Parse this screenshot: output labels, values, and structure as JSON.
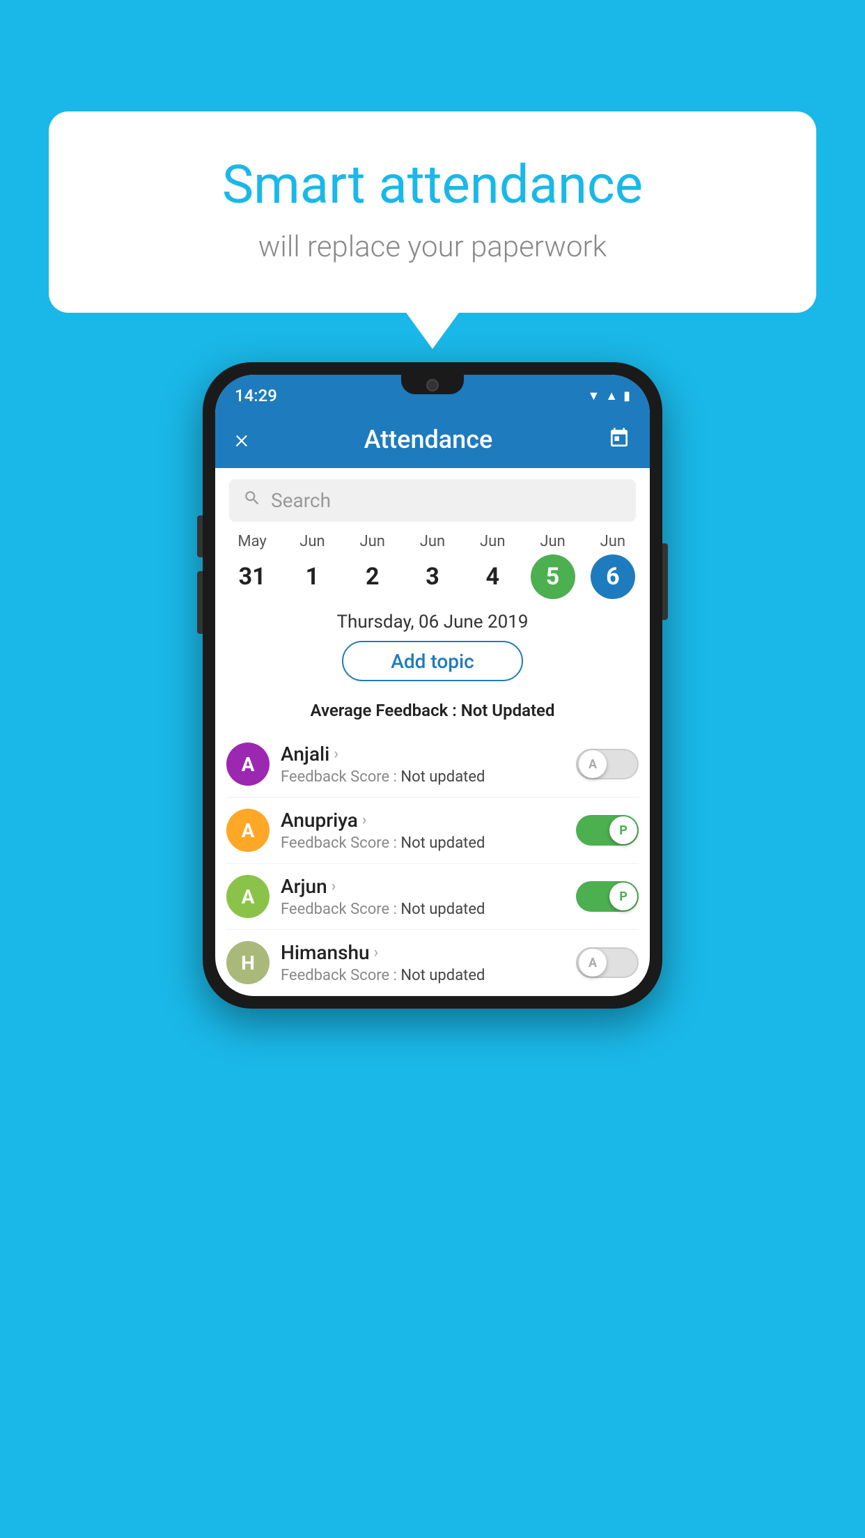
{
  "background_color": "#1ab8e8",
  "speech_bubble": {
    "title": "Smart attendance",
    "subtitle": "will replace your paperwork"
  },
  "status_bar": {
    "time": "14:29",
    "icons": [
      "wifi",
      "signal",
      "battery"
    ]
  },
  "app_bar": {
    "close_label": "×",
    "title": "Attendance",
    "calendar_icon": "calendar"
  },
  "search": {
    "placeholder": "Search"
  },
  "calendar": {
    "days": [
      {
        "month": "May",
        "date": "31",
        "state": "normal"
      },
      {
        "month": "Jun",
        "date": "1",
        "state": "normal"
      },
      {
        "month": "Jun",
        "date": "2",
        "state": "normal"
      },
      {
        "month": "Jun",
        "date": "3",
        "state": "normal"
      },
      {
        "month": "Jun",
        "date": "4",
        "state": "normal"
      },
      {
        "month": "Jun",
        "date": "5",
        "state": "green"
      },
      {
        "month": "Jun",
        "date": "6",
        "state": "blue"
      }
    ]
  },
  "selected_date": "Thursday, 06 June 2019",
  "add_topic_label": "Add topic",
  "average_feedback_label": "Average Feedback :",
  "average_feedback_value": "Not Updated",
  "students": [
    {
      "name": "Anjali",
      "avatar_letter": "A",
      "avatar_color": "#9c27b0",
      "feedback_label": "Feedback Score :",
      "feedback_value": "Not updated",
      "toggle": "off",
      "toggle_letter": "A"
    },
    {
      "name": "Anupriya",
      "avatar_letter": "A",
      "avatar_color": "#ffa726",
      "feedback_label": "Feedback Score :",
      "feedback_value": "Not updated",
      "toggle": "on",
      "toggle_letter": "P"
    },
    {
      "name": "Arjun",
      "avatar_letter": "A",
      "avatar_color": "#8bc34a",
      "feedback_label": "Feedback Score :",
      "feedback_value": "Not updated",
      "toggle": "on",
      "toggle_letter": "P"
    },
    {
      "name": "Himanshu",
      "avatar_letter": "H",
      "avatar_color": "#aab87a",
      "feedback_label": "Feedback Score :",
      "feedback_value": "Not updated",
      "toggle": "off",
      "toggle_letter": "A"
    }
  ]
}
